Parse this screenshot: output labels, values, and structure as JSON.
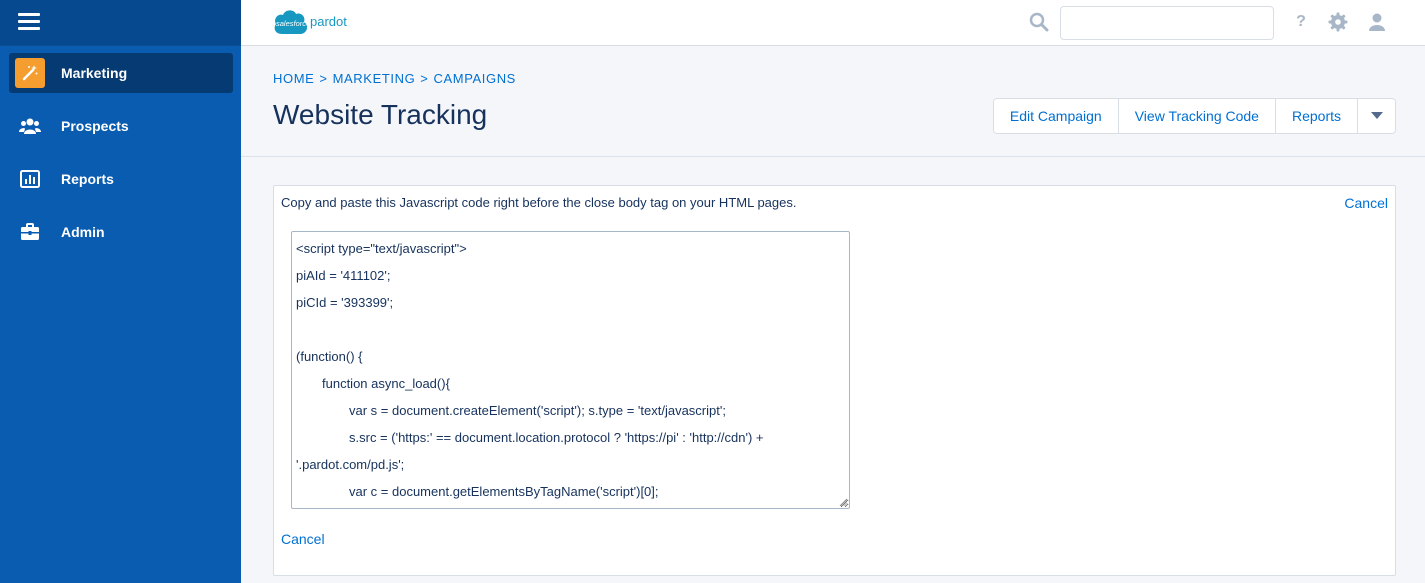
{
  "app": {
    "logo": {
      "brand": "salesforce",
      "product": "pardot"
    }
  },
  "colors": {
    "sidebar_bg": "#0a5cb0",
    "sidebar_active": "#063a72",
    "accent": "#0070d2",
    "marketing_icon_bg": "#f59d2f",
    "title": "#16325c"
  },
  "sidebar": {
    "items": [
      {
        "label": "Marketing",
        "icon": "magic-wand-icon",
        "active": true
      },
      {
        "label": "Prospects",
        "icon": "people-icon",
        "active": false
      },
      {
        "label": "Reports",
        "icon": "bar-chart-icon",
        "active": false
      },
      {
        "label": "Admin",
        "icon": "briefcase-icon",
        "active": false
      }
    ]
  },
  "header": {
    "search": {
      "value": "",
      "placeholder": ""
    },
    "help_label": "?"
  },
  "page": {
    "breadcrumb": [
      "HOME",
      "MARKETING",
      "CAMPAIGNS"
    ],
    "breadcrumb_separator": ">",
    "title": "Website Tracking",
    "actions": [
      "Edit Campaign",
      "View Tracking Code",
      "Reports"
    ]
  },
  "tracking": {
    "instructions": "Copy and paste this Javascript code right before the close body tag on your HTML pages.",
    "cancel_label": "Cancel",
    "code_lines": [
      "<script type=\"text/javascript\">",
      "piAId = '411102';",
      "piCId = '393399';",
      "",
      "(function() {",
      "function async_load(){",
      "var s = document.createElement('script'); s.type = 'text/javascript';",
      "s.src = ('https:' == document.location.protocol ? 'https://pi' : 'http://cdn') +",
      "'.pardot.com/pd.js';",
      "var c = document.getElementsByTagName('script')[0];"
    ]
  }
}
